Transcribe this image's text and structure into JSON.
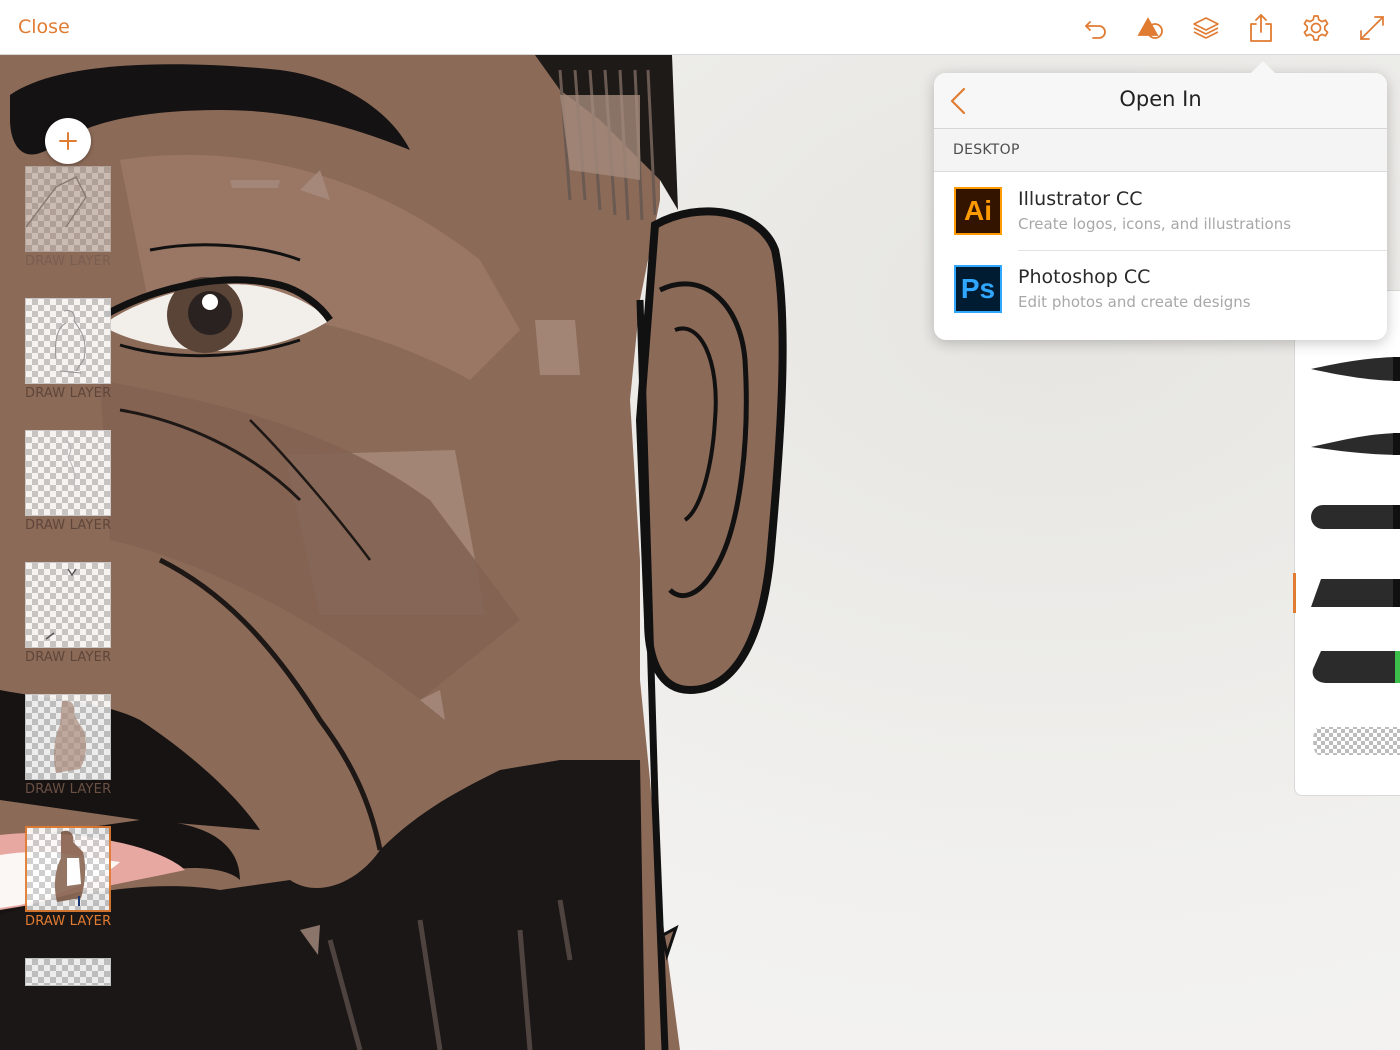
{
  "accent_color": "#e07b32",
  "toolbar": {
    "close_label": "Close",
    "icons": [
      "undo-icon",
      "shapes-icon",
      "layers-icon",
      "share-icon",
      "settings-icon",
      "fullscreen-icon"
    ]
  },
  "layers": {
    "items": [
      {
        "label": "DRAW LAYER",
        "selected": false
      },
      {
        "label": "DRAW LAYER",
        "selected": false
      },
      {
        "label": "DRAW LAYER",
        "selected": false
      },
      {
        "label": "DRAW LAYER",
        "selected": false
      },
      {
        "label": "DRAW LAYER",
        "selected": false
      },
      {
        "label": "DRAW LAYER",
        "selected": true
      },
      {
        "label": "",
        "selected": false
      }
    ]
  },
  "brushes": {
    "selected_index": 3,
    "items": [
      {
        "name": "pen-brush"
      },
      {
        "name": "taper-brush"
      },
      {
        "name": "round-brush"
      },
      {
        "name": "flat-brush"
      },
      {
        "name": "marker-brush"
      },
      {
        "name": "eraser-brush"
      }
    ]
  },
  "open_in": {
    "title": "Open In",
    "section": "DESKTOP",
    "apps": [
      {
        "icon_text": "Ai",
        "name": "Illustrator CC",
        "description": "Create logos, icons, and illustrations",
        "fg": "#ff9a00",
        "bg": "#331400"
      },
      {
        "icon_text": "Ps",
        "name": "Photoshop CC",
        "description": "Edit photos and create designs",
        "fg": "#31a8ff",
        "bg": "#001c33"
      }
    ]
  }
}
